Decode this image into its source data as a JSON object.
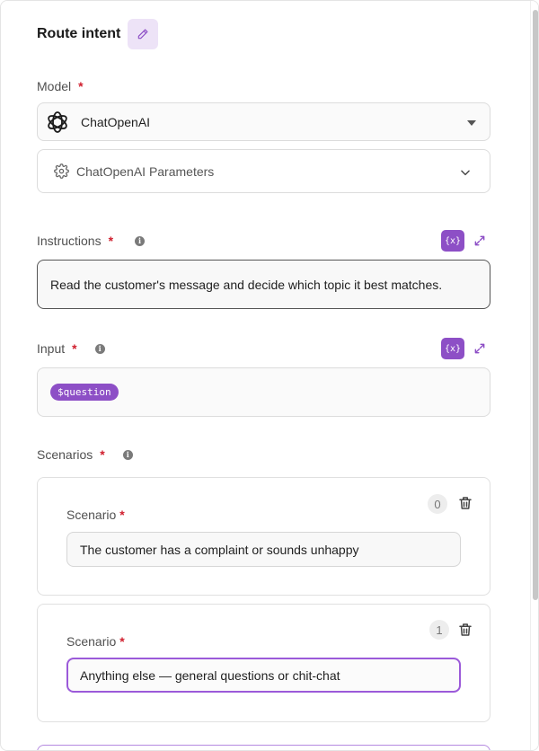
{
  "node": {
    "title": "Route intent"
  },
  "model": {
    "label": "Model",
    "required_mark": "*",
    "selected": "ChatOpenAI",
    "params_label": "ChatOpenAI Parameters"
  },
  "instructions": {
    "label": "Instructions",
    "required_mark": "*",
    "info_glyph": "i",
    "var_button": "{x}",
    "value": "Read the customer's message and decide which topic it best matches."
  },
  "input": {
    "label": "Input",
    "required_mark": "*",
    "info_glyph": "i",
    "var_button": "{x}",
    "chip": "$question"
  },
  "scenarios": {
    "label": "Scenarios",
    "required_mark": "*",
    "info_glyph": "i",
    "items": [
      {
        "index": "0",
        "label": "Scenario",
        "required_mark": "*",
        "value": "The customer has a complaint or sounds unhappy"
      },
      {
        "index": "1",
        "label": "Scenario",
        "required_mark": "*",
        "value": "Anything else — general questions or chit-chat"
      }
    ]
  },
  "colors": {
    "accent": "#8d4fc6",
    "focus_border": "#9b5ad9",
    "required": "#d01f2e"
  },
  "icons": {
    "edit": "pencil-icon",
    "model": "openai-logo-icon",
    "params": "gear-icon",
    "expand": "expand-icon",
    "delete": "trash-icon",
    "chevron": "chevron-down-icon"
  }
}
